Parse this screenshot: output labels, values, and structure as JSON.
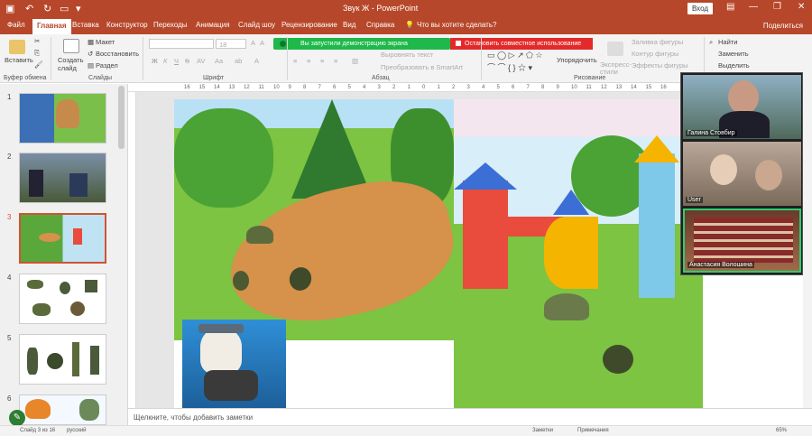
{
  "window": {
    "title": "Звук Ж  -  PowerPoint",
    "login": "Вход",
    "controls": [
      "—",
      "❐",
      "✕"
    ]
  },
  "tabs": [
    {
      "label": "Файл"
    },
    {
      "label": "Главная"
    },
    {
      "label": "Вставка"
    },
    {
      "label": "Конструктор"
    },
    {
      "label": "Переходы"
    },
    {
      "label": "Анимация"
    },
    {
      "label": "Слайд шоу"
    },
    {
      "label": "Рецензирование"
    },
    {
      "label": "Вид"
    },
    {
      "label": "Справка"
    },
    {
      "label": "Что вы хотите сделать?"
    }
  ],
  "share": "Поделиться",
  "ribbon": {
    "paste": "Вставить",
    "clipboard": "Буфер обмена",
    "new_slide": "Создать слайд",
    "layout": "Макет",
    "reset": "Восстановить",
    "section": "Раздел",
    "slides": "Слайды",
    "font": "Шрифт",
    "font_size": "18",
    "bold": "Ж",
    "italic": "К",
    "underline": "Ч",
    "strike": "S",
    "paragraph": "Абзац",
    "align_text": "Выровнять текст",
    "smartart": "Преобразовать в SmartArt",
    "arrange": "Упорядочить",
    "express": "Экспресс-стили",
    "drawing": "Рисование",
    "fill": "Заливка фигуры",
    "outline": "Контур фигуры",
    "effects": "Эффекты фигуры",
    "find": "Найти",
    "replace": "Заменить",
    "select": "Выделить",
    "share_banner": "Вы запустили демонстрацию экрана",
    "stop_share": "Остановить совместное использование"
  },
  "ruler_ticks": [
    "16",
    "15",
    "14",
    "13",
    "12",
    "11",
    "10",
    "9",
    "8",
    "7",
    "6",
    "5",
    "4",
    "3",
    "2",
    "1",
    "0",
    "1",
    "2",
    "3",
    "4",
    "5",
    "6",
    "7",
    "8",
    "9",
    "10",
    "11",
    "12",
    "13",
    "14",
    "15",
    "16"
  ],
  "slides": [
    {
      "num": "1"
    },
    {
      "num": "2"
    },
    {
      "num": "3"
    },
    {
      "num": "4"
    },
    {
      "num": "5"
    },
    {
      "num": "6"
    }
  ],
  "notes_placeholder": "Щелкните, чтобы добавить заметки",
  "status": {
    "slide_info": "Слайд 3 из 16",
    "lang": "русский",
    "notes": "Заметки",
    "comments": "Примечания",
    "zoom": "65%"
  },
  "participants": [
    {
      "name": "Галина Стовбир"
    },
    {
      "name": "User"
    },
    {
      "name": "Анастасия Волошина"
    }
  ],
  "colors": {
    "accent": "#b7472a",
    "selected": "#d35230",
    "share_green": "#1fb84a",
    "share_red": "#e32a2a"
  }
}
